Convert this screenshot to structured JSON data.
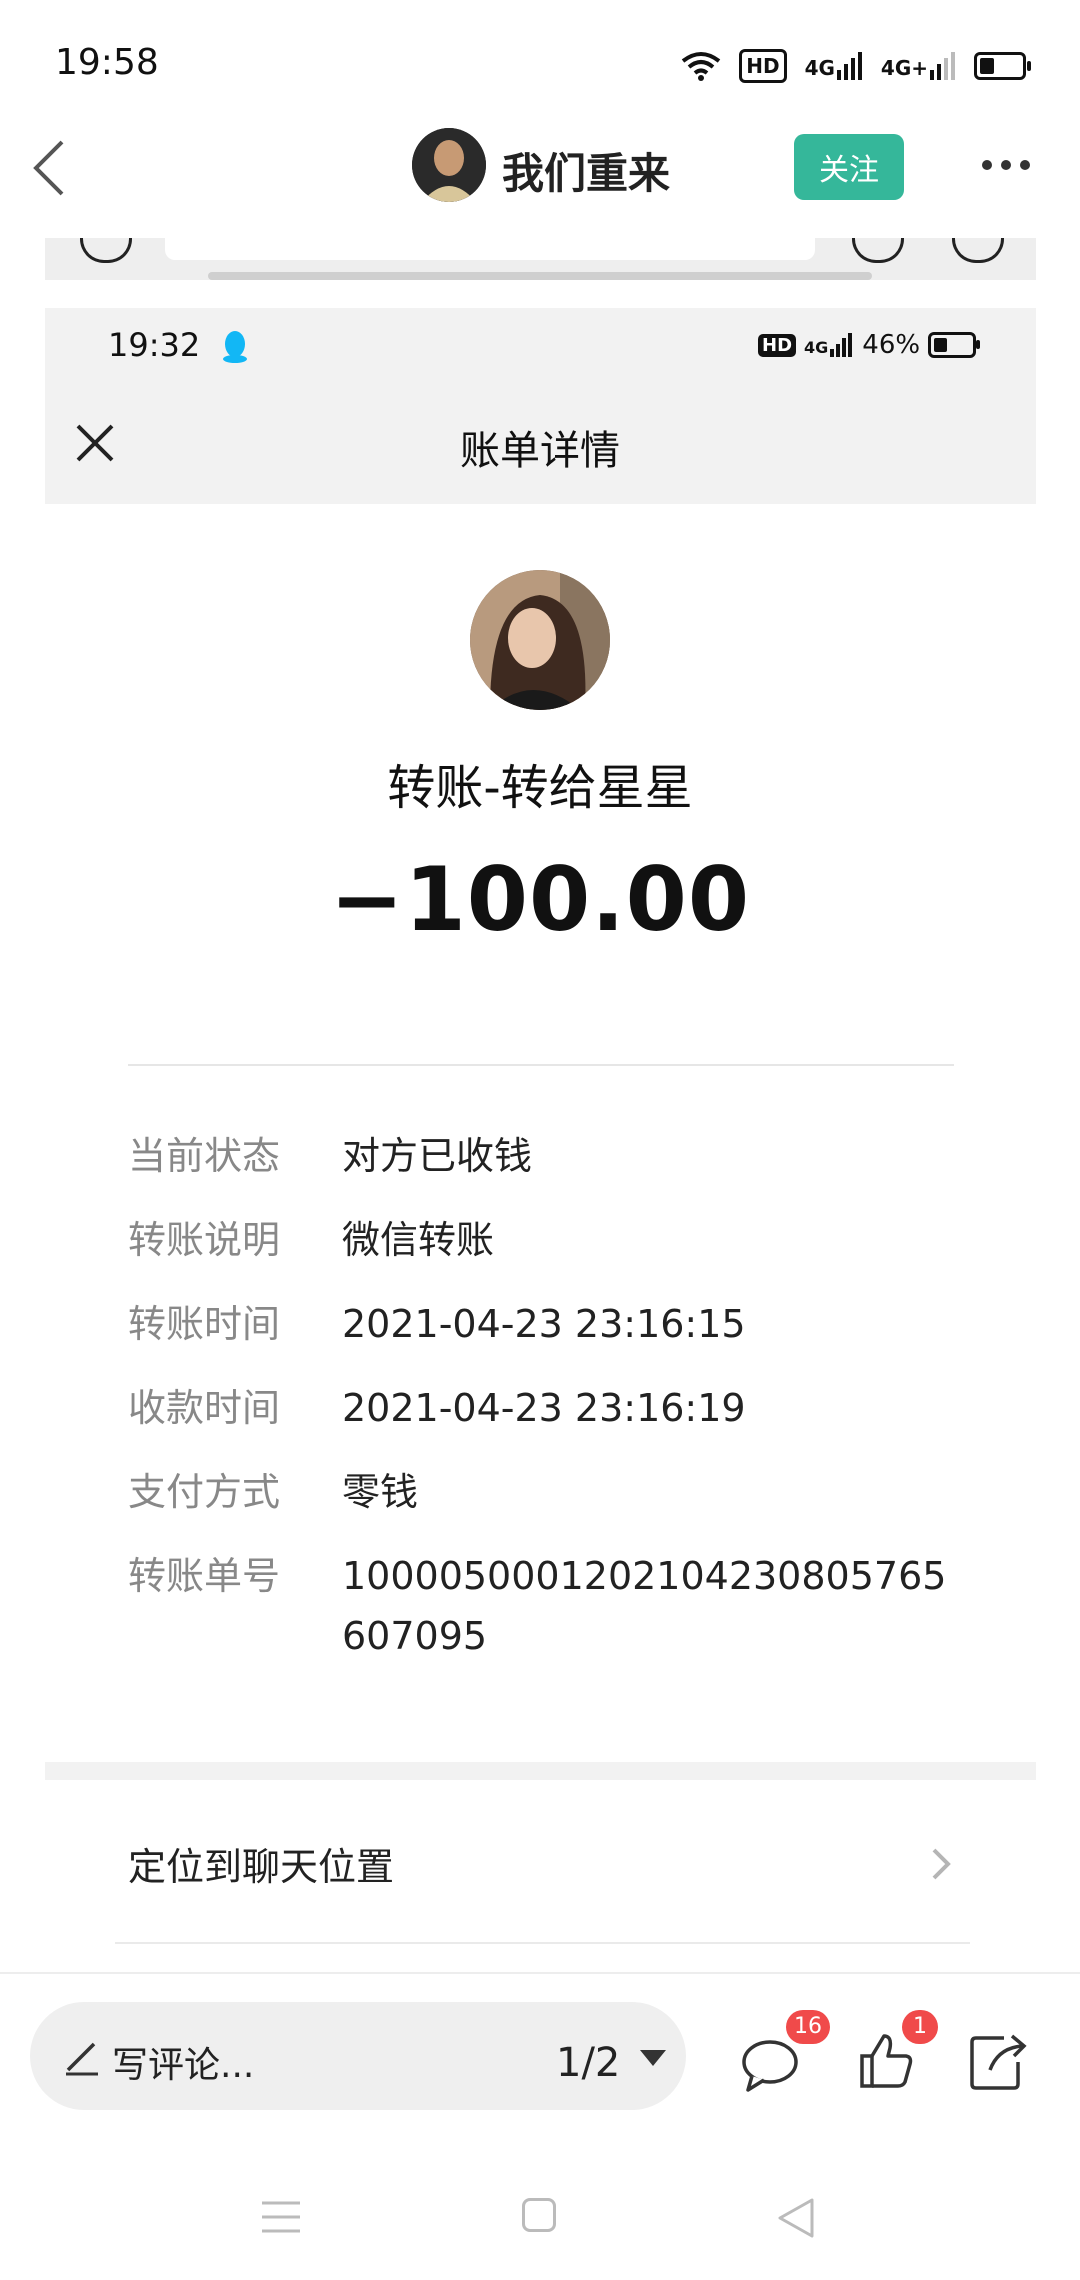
{
  "status_bar": {
    "time": "19:58",
    "hd_label": "HD",
    "net1": "4G",
    "net2": "4G+"
  },
  "header": {
    "author_name": "我们重来",
    "follow_label": "关注"
  },
  "inner_screenshot": {
    "time": "19:32",
    "hd_label": "HD",
    "net": "4G",
    "battery": "46%",
    "title": "账单详情"
  },
  "bill": {
    "payee": "转账-转给星星",
    "amount": "−100.00",
    "rows": [
      {
        "label": "当前状态",
        "value": "对方已收钱"
      },
      {
        "label": "转账说明",
        "value": "微信转账"
      },
      {
        "label": "转账时间",
        "value": "2021-04-23 23:16:15"
      },
      {
        "label": "收款时间",
        "value": "2021-04-23 23:16:19"
      },
      {
        "label": "支付方式",
        "value": "零钱"
      },
      {
        "label": "转账单号",
        "value": "1000050001202104230805765607095"
      }
    ],
    "locate_label": "定位到聊天位置"
  },
  "bottom_bar": {
    "comment_placeholder": "写评论...",
    "page_indicator": "1/2",
    "comment_count": "16",
    "like_count": "1"
  },
  "colors": {
    "follow_bg": "#35b79a",
    "badge_bg": "#f04a4a",
    "qq_blue": "#12b7f5"
  }
}
